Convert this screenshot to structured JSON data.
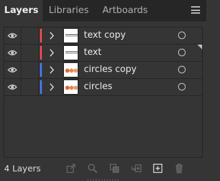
{
  "tabs": [
    {
      "label": "Layers",
      "active": true
    },
    {
      "label": "Libraries",
      "active": false
    },
    {
      "label": "Artboards",
      "active": false
    }
  ],
  "panel_menu_icon": "hamburger-menu-icon",
  "layers": [
    {
      "name": "text copy",
      "color": "#e8474f",
      "visible": true,
      "thumbnail": "text"
    },
    {
      "name": "text",
      "color": "#e8474f",
      "visible": true,
      "thumbnail": "text",
      "selected_art_mark": true
    },
    {
      "name": "circles copy",
      "color": "#4a72e8",
      "visible": true,
      "thumbnail": "circles"
    },
    {
      "name": "circles",
      "color": "#4a72e8",
      "visible": true,
      "thumbnail": "circles"
    }
  ],
  "footer": {
    "count_label": "4 Layers",
    "icons": [
      "export-icon",
      "locate-object-icon",
      "make-clipping-mask-icon",
      "create-sublayer-icon",
      "new-layer-icon",
      "delete-icon"
    ]
  },
  "colors": {
    "panel_bg": "#353535",
    "tabbar_bg": "#262626",
    "red_layer": "#e8474f",
    "blue_layer": "#4a72e8",
    "circle_dot_1": "#e0663b",
    "circle_dot_2": "#e89a6a"
  }
}
